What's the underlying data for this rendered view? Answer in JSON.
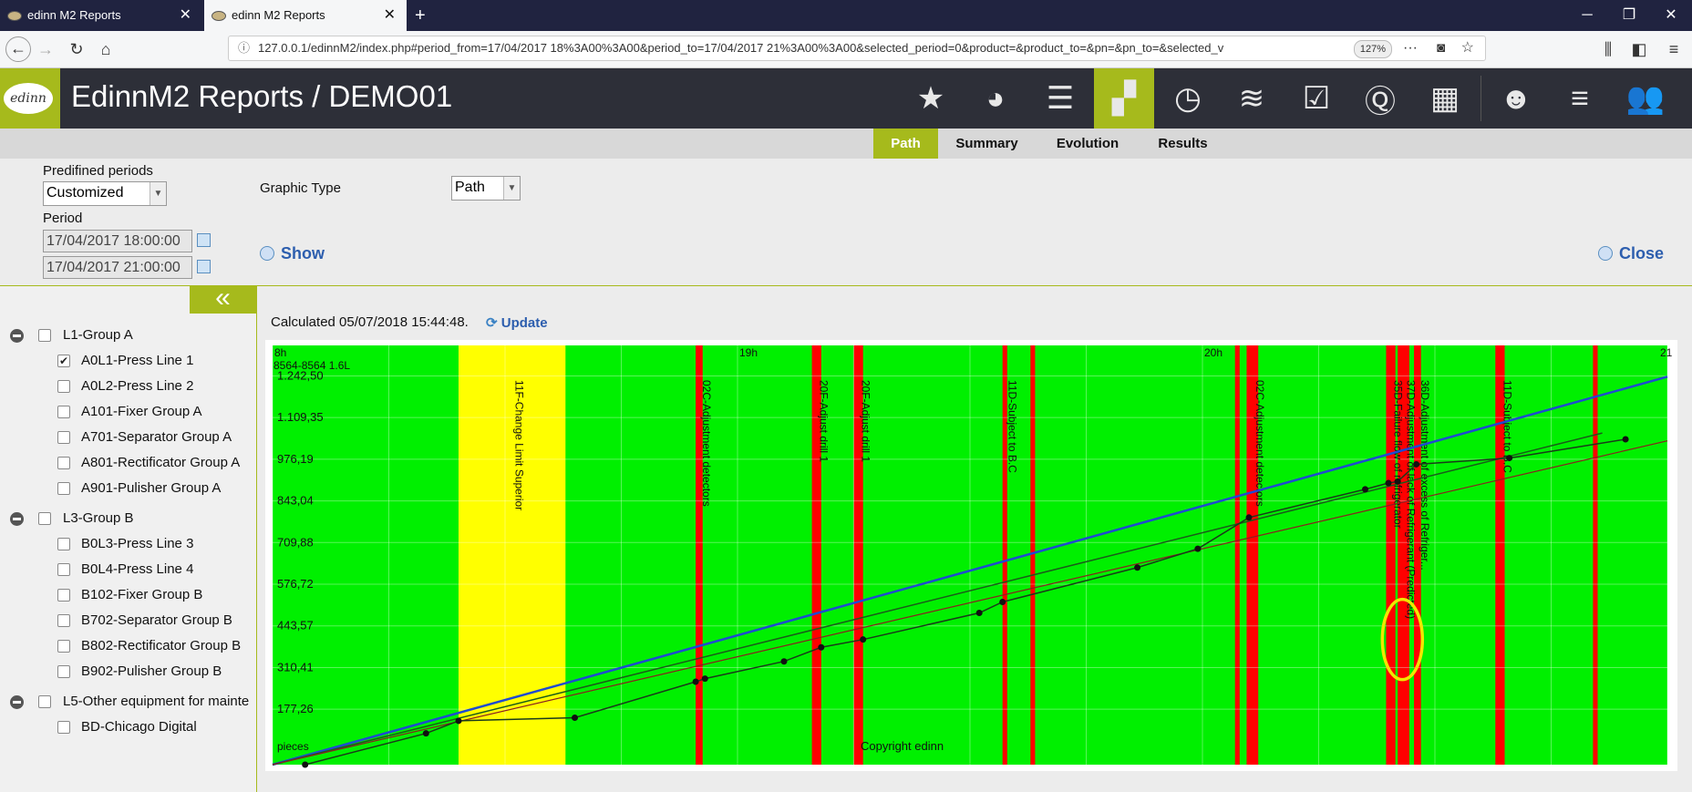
{
  "browser": {
    "tabs": [
      {
        "title": "edinn M2 Reports",
        "active": false
      },
      {
        "title": "edinn M2 Reports",
        "active": true
      }
    ],
    "url": "127.0.0.1/edinnM2/index.php#period_from=17/04/2017 18%3A00%3A00&period_to=17/04/2017 21%3A00%3A00&selected_period=0&product=&product_to=&pn=&pn_to=&selected_v",
    "zoom": "127%"
  },
  "app": {
    "title": "EdinnM2 Reports / DEMO01",
    "logo_text": "edinn",
    "brand_color": "#a6ba1c",
    "header_icons": [
      "star-icon",
      "pie-chart-icon",
      "bars-icon",
      "blocks-icon",
      "clock-icon",
      "coins-icon",
      "checklist-icon",
      "quality-icon",
      "grid-icon",
      "operator-icon",
      "menu-icon",
      "user-icon"
    ]
  },
  "subtabs": [
    "Path",
    "Summary",
    "Evolution",
    "Results"
  ],
  "filters": {
    "predefined_label": "Predifined periods",
    "predefined_value": "Customized",
    "period_label": "Period",
    "period_from": "17/04/2017 18:00:00",
    "period_to": "17/04/2017 21:00:00",
    "graphic_type_label": "Graphic Type",
    "graphic_type_value": "Path",
    "show_label": "Show",
    "close_label": "Close"
  },
  "sidebar": {
    "collapse_glyph": "«",
    "groups": [
      {
        "label": "L1-Group A",
        "items": [
          {
            "label": "A0L1-Press Line 1",
            "checked": true
          },
          {
            "label": "A0L2-Press Line 2",
            "checked": false
          },
          {
            "label": "A101-Fixer Group A",
            "checked": false
          },
          {
            "label": "A701-Separator Group A",
            "checked": false
          },
          {
            "label": "A801-Rectificator Group A",
            "checked": false
          },
          {
            "label": "A901-Pulisher Group A",
            "checked": false
          }
        ]
      },
      {
        "label": "L3-Group B",
        "items": [
          {
            "label": "B0L3-Press Line 3",
            "checked": false
          },
          {
            "label": "B0L4-Press Line 4",
            "checked": false
          },
          {
            "label": "B102-Fixer Group B",
            "checked": false
          },
          {
            "label": "B702-Separator Group B",
            "checked": false
          },
          {
            "label": "B802-Rectificator Group B",
            "checked": false
          },
          {
            "label": "B902-Pulisher Group B",
            "checked": false
          }
        ]
      },
      {
        "label": "L5-Other equipment for mainte",
        "items": [
          {
            "label": "BD-Chicago Digital",
            "checked": false
          }
        ]
      }
    ]
  },
  "main": {
    "calculated_text": "Calculated 05/07/2018 15:44:48.",
    "update_label": "Update"
  },
  "chart_data": {
    "type": "line",
    "x_ticks": [
      "8h",
      "19h",
      "20h",
      "21"
    ],
    "xlim_hours": [
      18,
      21
    ],
    "ylim": [
      0,
      1340
    ],
    "y_ticks": [
      "1.242,50",
      "1.109,35",
      "976,19",
      "843,04",
      "709,88",
      "576,72",
      "443,57",
      "310,41",
      "177,26"
    ],
    "y_tick_values": [
      1242.5,
      1109.35,
      976.19,
      843.04,
      709.88,
      576.72,
      443.57,
      310.41,
      177.26
    ],
    "ylabel": "pieces",
    "top_left_label": "8564-8564 1.6L",
    "watermark": "Copyright edinn",
    "colors": {
      "running": "#00f000",
      "warning": "#ffff00",
      "stop": "#ff0000",
      "highlight": "#f2e600"
    },
    "yellow_periods": [
      {
        "from": 18.4,
        "to": 18.63,
        "label": "11F-Change Limit Superior"
      }
    ],
    "red_periods": [
      {
        "from": 18.91,
        "to": 18.925,
        "label": "02C-Adjustment detectors"
      },
      {
        "from": 19.16,
        "to": 19.18,
        "label": "20F-Adjust drill 1"
      },
      {
        "from": 19.25,
        "to": 19.27,
        "label": "20F-Adjust drill 1"
      },
      {
        "from": 19.57,
        "to": 19.58,
        "label": "11D-Subject to B.C"
      },
      {
        "from": 19.63,
        "to": 19.64,
        "label": ""
      },
      {
        "from": 20.07,
        "to": 20.08,
        "label": ""
      },
      {
        "from": 20.095,
        "to": 20.12,
        "label": "02C-Adjustment detectors"
      },
      {
        "from": 20.395,
        "to": 20.415,
        "label": "35D-Failure flow of refrigerator"
      },
      {
        "from": 20.42,
        "to": 20.445,
        "label": "37D-Adjustment of lack of Refrigerant (Predicted)"
      },
      {
        "from": 20.455,
        "to": 20.47,
        "label": "36D-Adjustment of excess of Refriger..."
      },
      {
        "from": 20.63,
        "to": 20.65,
        "label": "11D-Subject to B.C"
      },
      {
        "from": 20.84,
        "to": 20.85,
        "label": ""
      }
    ],
    "series": [
      {
        "name": "",
        "color": "#1f4bd0",
        "width": 2.5,
        "x": [
          18,
          21
        ],
        "y": [
          0,
          1240
        ]
      },
      {
        "name": "",
        "color": "#1a5c1a",
        "width": 1.5,
        "x": [
          18,
          20.86
        ],
        "y": [
          0,
          1060
        ]
      },
      {
        "name": "",
        "color": "#8a2020",
        "width": 1.2,
        "x": [
          18,
          21
        ],
        "y": [
          0,
          1035
        ]
      },
      {
        "name": "",
        "color": "#1a3a1a",
        "width": 1.5,
        "x": [
          18.07,
          18.33,
          18.4,
          18.65,
          18.91,
          18.93,
          19.1,
          19.18,
          19.27,
          19.52,
          19.57,
          19.86,
          19.99,
          20.1,
          20.35,
          20.4,
          20.42,
          20.46,
          20.66,
          20.91
        ],
        "y": [
          0,
          100,
          140,
          150,
          265,
          275,
          330,
          375,
          400,
          485,
          520,
          630,
          690,
          790,
          880,
          900,
          905,
          960,
          980,
          1040
        ]
      }
    ],
    "highlight_ellipse": {
      "x": 20.43,
      "y": 400
    }
  }
}
